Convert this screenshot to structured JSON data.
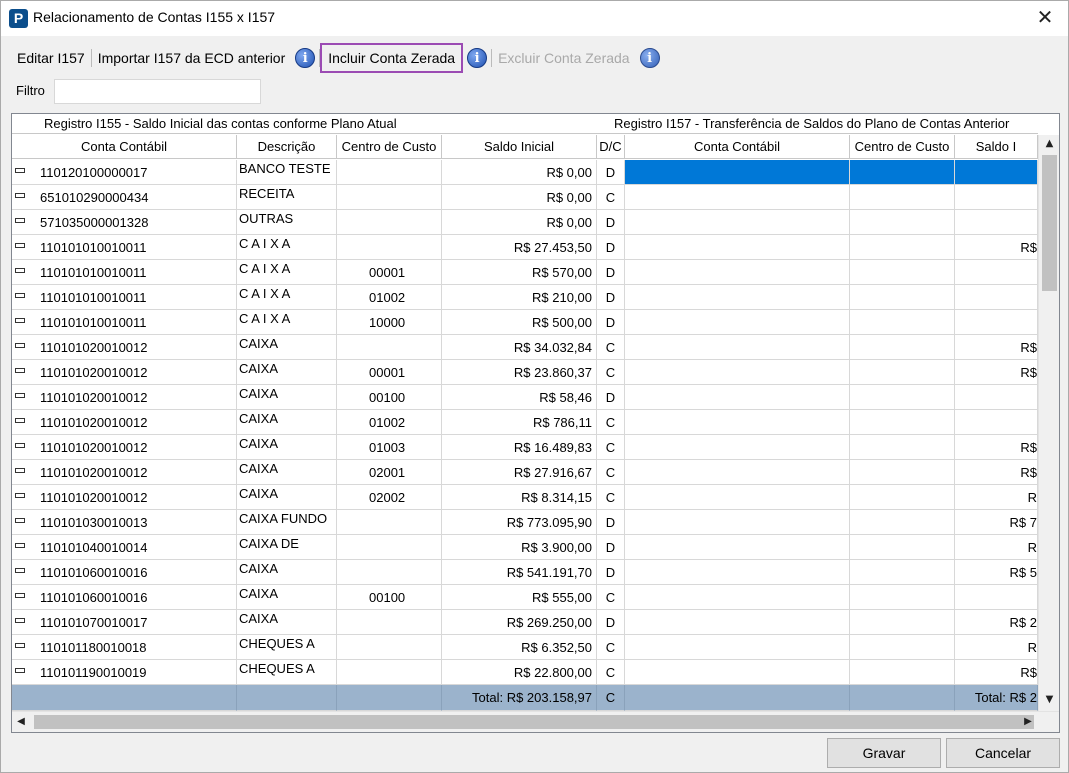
{
  "window": {
    "title": "Relacionamento de Contas I155 x I157",
    "close": "✕",
    "app_icon_letter": "P"
  },
  "toolbar": {
    "edit_label": "Editar I157",
    "import_label": "Importar I157 da ECD anterior",
    "include_label": "Incluir Conta Zerada",
    "exclude_label": "Excluir Conta Zerada",
    "info_glyph": "i"
  },
  "filter": {
    "label": "Filtro",
    "value": ""
  },
  "grid": {
    "group_left": "Registro I155 - Saldo Inicial das contas conforme Plano Atual",
    "group_right": "Registro I157 - Transferência de Saldos do Plano de Contas Anterior",
    "columns": [
      "Conta Contábil",
      "Descrição",
      "Centro de Custo",
      "Saldo Inicial",
      "D/C",
      "Conta Contábil",
      "Centro de Custo",
      "Saldo I"
    ],
    "rows": [
      {
        "conta": "110120100000017",
        "desc": "BANCO TESTE",
        "cc": "",
        "saldo": "R$ 0,00",
        "dc": "D",
        "r_saldo": ""
      },
      {
        "conta": "651010290000434",
        "desc": "RECEITA",
        "cc": "",
        "saldo": "R$ 0,00",
        "dc": "C",
        "r_saldo": ""
      },
      {
        "conta": "571035000001328",
        "desc": "OUTRAS",
        "cc": "",
        "saldo": "R$ 0,00",
        "dc": "D",
        "r_saldo": ""
      },
      {
        "conta": "110101010010011",
        "desc": "C A I X A",
        "cc": "",
        "saldo": "R$ 27.453,50",
        "dc": "D",
        "r_saldo": "R$"
      },
      {
        "conta": "110101010010011",
        "desc": "C A I X A",
        "cc": "00001",
        "saldo": "R$ 570,00",
        "dc": "D",
        "r_saldo": ""
      },
      {
        "conta": "110101010010011",
        "desc": "C A I X A",
        "cc": "01002",
        "saldo": "R$ 210,00",
        "dc": "D",
        "r_saldo": ""
      },
      {
        "conta": "110101010010011",
        "desc": "C A I X A",
        "cc": "10000",
        "saldo": "R$ 500,00",
        "dc": "D",
        "r_saldo": ""
      },
      {
        "conta": "110101020010012",
        "desc": "CAIXA",
        "cc": "",
        "saldo": "R$ 34.032,84",
        "dc": "C",
        "r_saldo": "R$"
      },
      {
        "conta": "110101020010012",
        "desc": "CAIXA",
        "cc": "00001",
        "saldo": "R$ 23.860,37",
        "dc": "C",
        "r_saldo": "R$"
      },
      {
        "conta": "110101020010012",
        "desc": "CAIXA",
        "cc": "00100",
        "saldo": "R$ 58,46",
        "dc": "D",
        "r_saldo": ""
      },
      {
        "conta": "110101020010012",
        "desc": "CAIXA",
        "cc": "01002",
        "saldo": "R$ 786,11",
        "dc": "C",
        "r_saldo": ""
      },
      {
        "conta": "110101020010012",
        "desc": "CAIXA",
        "cc": "01003",
        "saldo": "R$ 16.489,83",
        "dc": "C",
        "r_saldo": "R$"
      },
      {
        "conta": "110101020010012",
        "desc": "CAIXA",
        "cc": "02001",
        "saldo": "R$ 27.916,67",
        "dc": "C",
        "r_saldo": "R$"
      },
      {
        "conta": "110101020010012",
        "desc": "CAIXA",
        "cc": "02002",
        "saldo": "R$ 8.314,15",
        "dc": "C",
        "r_saldo": "R"
      },
      {
        "conta": "110101030010013",
        "desc": "CAIXA FUNDO",
        "cc": "",
        "saldo": "R$ 773.095,90",
        "dc": "D",
        "r_saldo": "R$ 7"
      },
      {
        "conta": "110101040010014",
        "desc": "CAIXA DE",
        "cc": "",
        "saldo": "R$ 3.900,00",
        "dc": "D",
        "r_saldo": "R"
      },
      {
        "conta": "110101060010016",
        "desc": "CAIXA",
        "cc": "",
        "saldo": "R$ 541.191,70",
        "dc": "D",
        "r_saldo": "R$ 5"
      },
      {
        "conta": "110101060010016",
        "desc": "CAIXA",
        "cc": "00100",
        "saldo": "R$ 555,00",
        "dc": "C",
        "r_saldo": ""
      },
      {
        "conta": "110101070010017",
        "desc": "CAIXA",
        "cc": "",
        "saldo": "R$ 269.250,00",
        "dc": "D",
        "r_saldo": "R$ 2"
      },
      {
        "conta": "110101180010018",
        "desc": "CHEQUES A",
        "cc": "",
        "saldo": "R$ 6.352,50",
        "dc": "C",
        "r_saldo": "R"
      },
      {
        "conta": "110101190010019",
        "desc": "CHEQUES A",
        "cc": "",
        "saldo": "R$ 22.800,00",
        "dc": "C",
        "r_saldo": "R$"
      }
    ],
    "total_left": "Total: R$ 203.158,97",
    "total_dc": "C",
    "total_right": "Total: R$ 2",
    "selection_color": "#0078d7",
    "total_row_color": "#9bb3cc"
  },
  "buttons": {
    "save_label": "Gravar",
    "cancel_label": "Cancelar"
  },
  "colors": {
    "highlight_border": "#9b4bb3"
  }
}
